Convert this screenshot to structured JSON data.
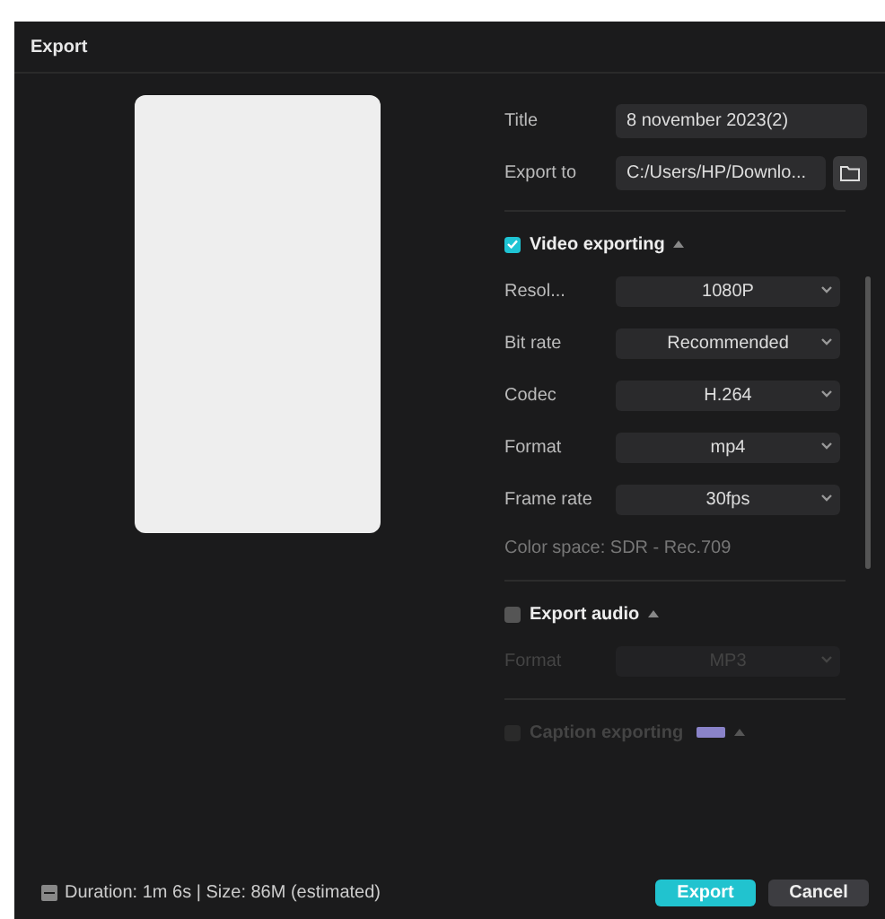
{
  "window": {
    "title": "Export"
  },
  "title_field": {
    "label": "Title",
    "value": "8 november 2023(2)"
  },
  "export_to": {
    "label": "Export to",
    "value": "C:/Users/HP/Downlo..."
  },
  "sections": [
    {
      "label": "Video exporting",
      "checked": true,
      "disabled": false,
      "expanded": true,
      "rows": [
        {
          "label": "Resol...",
          "value": "1080P",
          "disabled": false
        },
        {
          "label": "Bit rate",
          "value": "Recommended",
          "disabled": false
        },
        {
          "label": "Codec",
          "value": "H.264",
          "disabled": false
        },
        {
          "label": "Format",
          "value": "mp4",
          "disabled": false
        },
        {
          "label": "Frame rate",
          "value": "30fps",
          "disabled": false
        }
      ],
      "note": "Color space: SDR - Rec.709"
    },
    {
      "label": "Export audio",
      "checked": false,
      "disabled": false,
      "expanded": true,
      "rows": [
        {
          "label": "Format",
          "value": "MP3",
          "disabled": true
        }
      ]
    },
    {
      "label": "Caption exporting",
      "checked": false,
      "disabled": true,
      "expanded": true,
      "pro": true
    }
  ],
  "status": "Duration: 1m 6s | Size: 86M (estimated)",
  "buttons": [
    {
      "label": "Export",
      "kind": "primary"
    },
    {
      "label": "Cancel",
      "kind": "secondary"
    }
  ]
}
